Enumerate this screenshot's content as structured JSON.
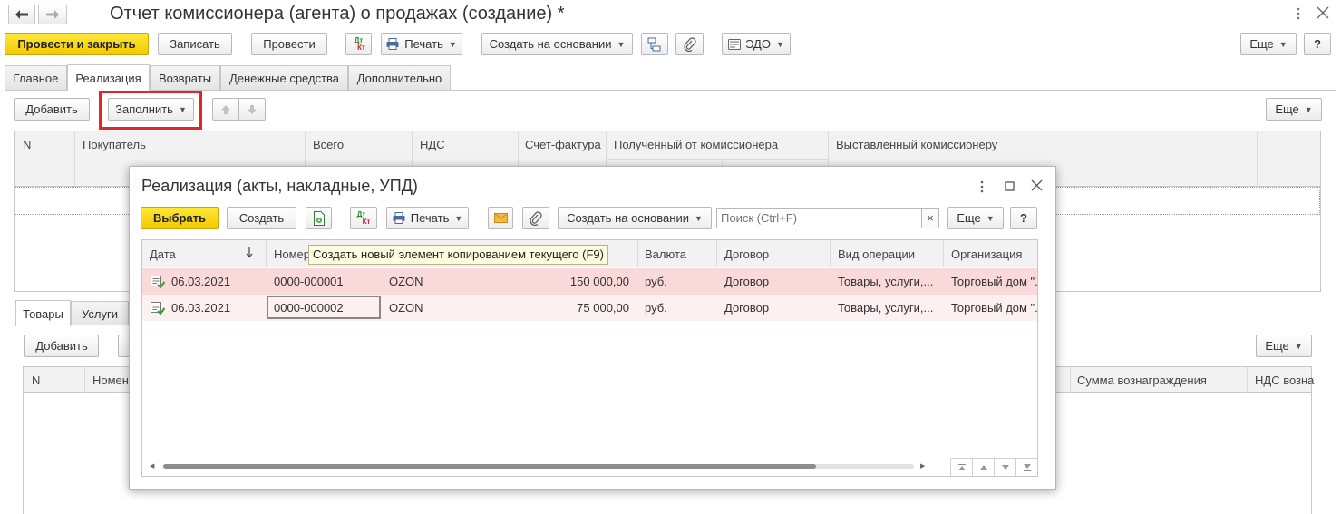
{
  "window": {
    "title": "Отчет комиссионера (агента) о продажах (создание) *"
  },
  "toolbar": {
    "post_close": "Провести и закрыть",
    "save": "Записать",
    "post": "Провести",
    "dtkt_top": "Дт",
    "dtkt_bottom": "Кт",
    "print": "Печать",
    "create_based": "Создать на основании",
    "edo": "ЭДО",
    "more": "Еще",
    "help": "?"
  },
  "tabs": [
    "Главное",
    "Реализация",
    "Возвраты",
    "Денежные средства",
    "Дополнительно"
  ],
  "realization": {
    "add": "Добавить",
    "fill": "Заполнить",
    "more": "Еще",
    "columns": {
      "n": "N",
      "buyer": "Покупатель",
      "total": "Всего",
      "vat": "НДС",
      "invoice": "Счет-фактура",
      "received": "Полученный от комиссионера",
      "issued": "Выставленный комиссионеру"
    }
  },
  "lower": {
    "tabs": [
      "Товары",
      "Услуги"
    ],
    "add": "Добавить",
    "more": "Еще",
    "columns": {
      "n": "N",
      "nomen": "Номен",
      "reward": "Сумма вознаграждения",
      "vat_reward": "НДС возна"
    }
  },
  "dialog": {
    "title": "Реализация (акты, накладные, УПД)",
    "select": "Выбрать",
    "create": "Создать",
    "print": "Печать",
    "create_based": "Создать на основании",
    "search_placeholder": "Поиск (Ctrl+F)",
    "search_clear": "×",
    "more": "Еще",
    "help": "?",
    "tooltip": "Создать новый элемент копированием текущего (F9)",
    "columns": {
      "date": "Дата",
      "number": "Номер",
      "currency": "Валюта",
      "contract": "Договор",
      "op_type": "Вид операции",
      "org": "Организация"
    },
    "rows": [
      {
        "date": "06.03.2021",
        "number": "0000-000001",
        "counterparty": "OZON",
        "sum": "150 000,00",
        "currency": "руб.",
        "contract": "Договор",
        "op_type": "Товары, услуги,...",
        "org": "Торговый дом \"."
      },
      {
        "date": "06.03.2021",
        "number": "0000-000002",
        "counterparty": "OZON",
        "sum": "75 000,00",
        "currency": "руб.",
        "contract": "Договор",
        "op_type": "Товары, услуги,...",
        "org": "Торговый дом \"."
      }
    ]
  },
  "colors": {
    "accent_yellow": "#f4c800",
    "highlight_red": "#e0262b",
    "row_selected": "#f9d9d9",
    "row_alt": "#fdf0f0"
  }
}
